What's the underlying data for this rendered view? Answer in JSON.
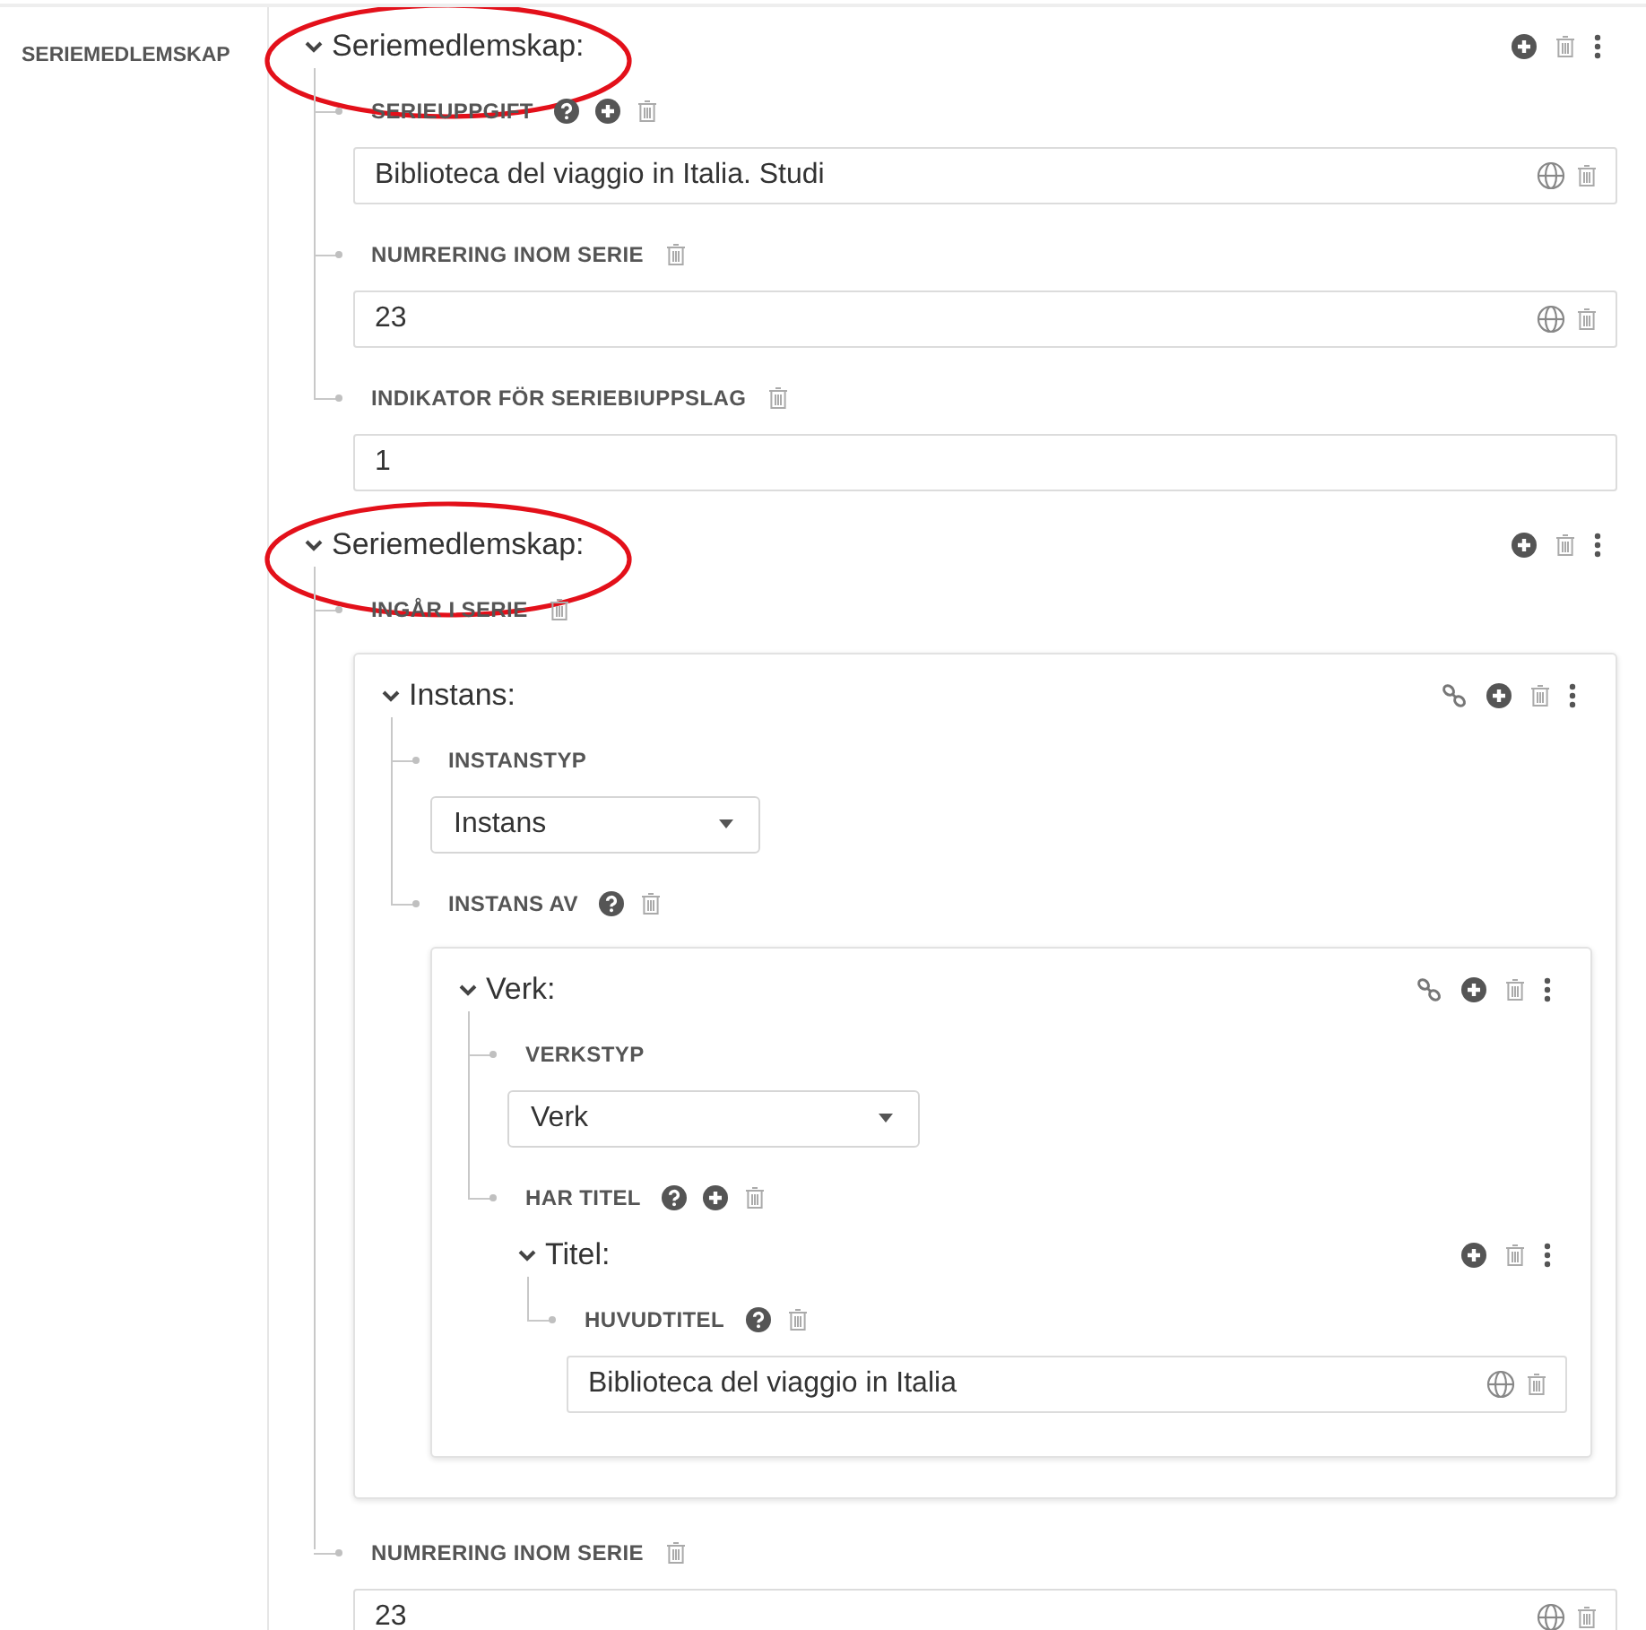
{
  "sidebar": {
    "label": "SERIEMEDLEMSKAP"
  },
  "entities": [
    {
      "title": "Seriemedlemskap:",
      "expanded": true,
      "circled": true,
      "add": true,
      "delete": true,
      "menu": true,
      "properties": [
        {
          "label": "SERIEUPPGIFT",
          "help": true,
          "add": true,
          "delete": true,
          "values": [
            {
              "kind": "text",
              "value": "Biblioteca del viaggio in Italia. Studi",
              "language": true,
              "delete": true
            }
          ]
        },
        {
          "label": "NUMRERING INOM SERIE",
          "delete": true,
          "values": [
            {
              "kind": "text",
              "value": "23",
              "language": true,
              "delete": true
            }
          ]
        },
        {
          "label": "INDIKATOR FÖR SERIEBIUPPSLAG",
          "delete": true,
          "values": [
            {
              "kind": "text",
              "value": "1"
            }
          ]
        }
      ]
    },
    {
      "title": "Seriemedlemskap:",
      "expanded": true,
      "circled": true,
      "add": true,
      "delete": true,
      "menu": true,
      "properties": [
        {
          "label": "INGÅR I SERIE",
          "delete": true,
          "values": [
            {
              "kind": "entity",
              "title": "Instans:",
              "expanded": true,
              "card": true,
              "link": true,
              "add": true,
              "delete": true,
              "menu": true,
              "properties": [
                {
                  "label": "INSTANSTYP",
                  "values": [
                    {
                      "kind": "select",
                      "value": "Instans"
                    }
                  ]
                },
                {
                  "label": "INSTANS AV",
                  "help": true,
                  "delete": true,
                  "values": [
                    {
                      "kind": "entity",
                      "title": "Verk:",
                      "expanded": true,
                      "card": true,
                      "link": true,
                      "add": true,
                      "delete": true,
                      "menu": true,
                      "properties": [
                        {
                          "label": "VERKSTYP",
                          "values": [
                            {
                              "kind": "select",
                              "value": "Verk"
                            }
                          ]
                        },
                        {
                          "label": "HAR TITEL",
                          "help": true,
                          "add": true,
                          "delete": true,
                          "values": [
                            {
                              "kind": "entity",
                              "title": "Titel:",
                              "expanded": true,
                              "add": true,
                              "delete": true,
                              "menu": true,
                              "properties": [
                                {
                                  "label": "HUVUDTITEL",
                                  "help": true,
                                  "delete": true,
                                  "values": [
                                    {
                                      "kind": "text",
                                      "value": "Biblioteca del viaggio in Italia",
                                      "language": true,
                                      "delete": true
                                    }
                                  ]
                                }
                              ]
                            }
                          ]
                        }
                      ]
                    }
                  ]
                }
              ]
            }
          ]
        },
        {
          "label": "NUMRERING INOM SERIE",
          "delete": true,
          "values": [
            {
              "kind": "text",
              "value": "23",
              "language": true,
              "delete": true
            }
          ]
        }
      ]
    }
  ]
}
